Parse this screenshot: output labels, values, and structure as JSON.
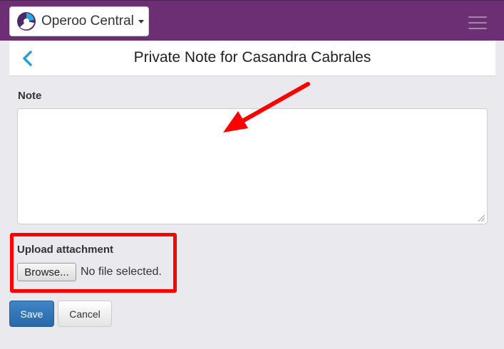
{
  "topbar": {
    "app_name": "Operoo Central",
    "logo_icon": "operoo-logo-icon",
    "menu_icon": "hamburger-menu-icon",
    "background_color": "#6c2f73"
  },
  "header": {
    "title": "Private Note for Casandra Cabrales",
    "back_icon": "chevron-left-icon",
    "accent_color": "#2a9fd6"
  },
  "form": {
    "note_label": "Note",
    "note_value": "",
    "upload_label": "Upload attachment",
    "browse_label": "Browse...",
    "file_status": "No file selected."
  },
  "actions": {
    "save_label": "Save",
    "cancel_label": "Cancel",
    "save_color": "#337ab7"
  },
  "annotations": {
    "highlight_color": "#ff0000",
    "arrow_color": "#ff0000"
  }
}
